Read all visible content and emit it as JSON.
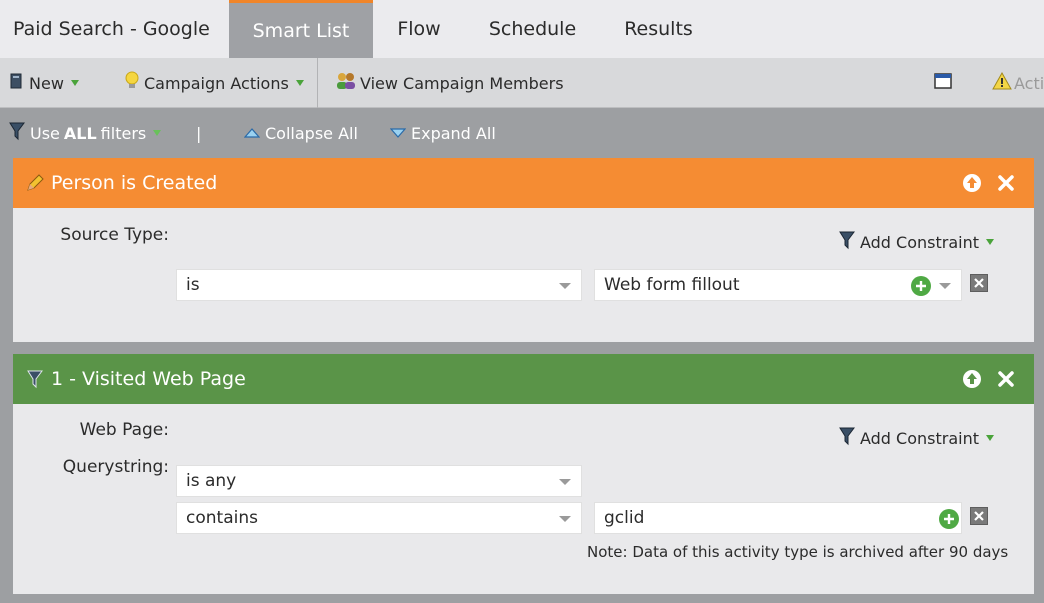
{
  "tabs": [
    {
      "label": "Paid Search - Google"
    },
    {
      "label": "Smart List"
    },
    {
      "label": "Flow"
    },
    {
      "label": "Schedule"
    },
    {
      "label": "Results"
    }
  ],
  "toolbar": {
    "new_label": "New",
    "campaign_actions_label": "Campaign Actions",
    "view_members_label": "View Campaign Members",
    "active_label": "Activ"
  },
  "filterbar": {
    "use_label": "Use",
    "all_label": "ALL",
    "filters_label": "filters",
    "separator": "|",
    "collapse_label": "Collapse All",
    "expand_label": "Expand All"
  },
  "filters": [
    {
      "title": "Person is Created",
      "color": "#f58c33",
      "add_constraint": "Add Constraint",
      "rows": [
        {
          "label": "Source Type:",
          "operator": "is",
          "value": "Web form fillout"
        }
      ]
    },
    {
      "title": "1 - Visited Web Page",
      "color": "#5a9448",
      "add_constraint": "Add Constraint",
      "rows": [
        {
          "label": "Web Page:",
          "operator": "is any"
        },
        {
          "label": "Querystring:",
          "operator": "contains",
          "value": "gclid"
        }
      ],
      "note": "Note: Data of this activity type is archived after 90 days"
    }
  ]
}
